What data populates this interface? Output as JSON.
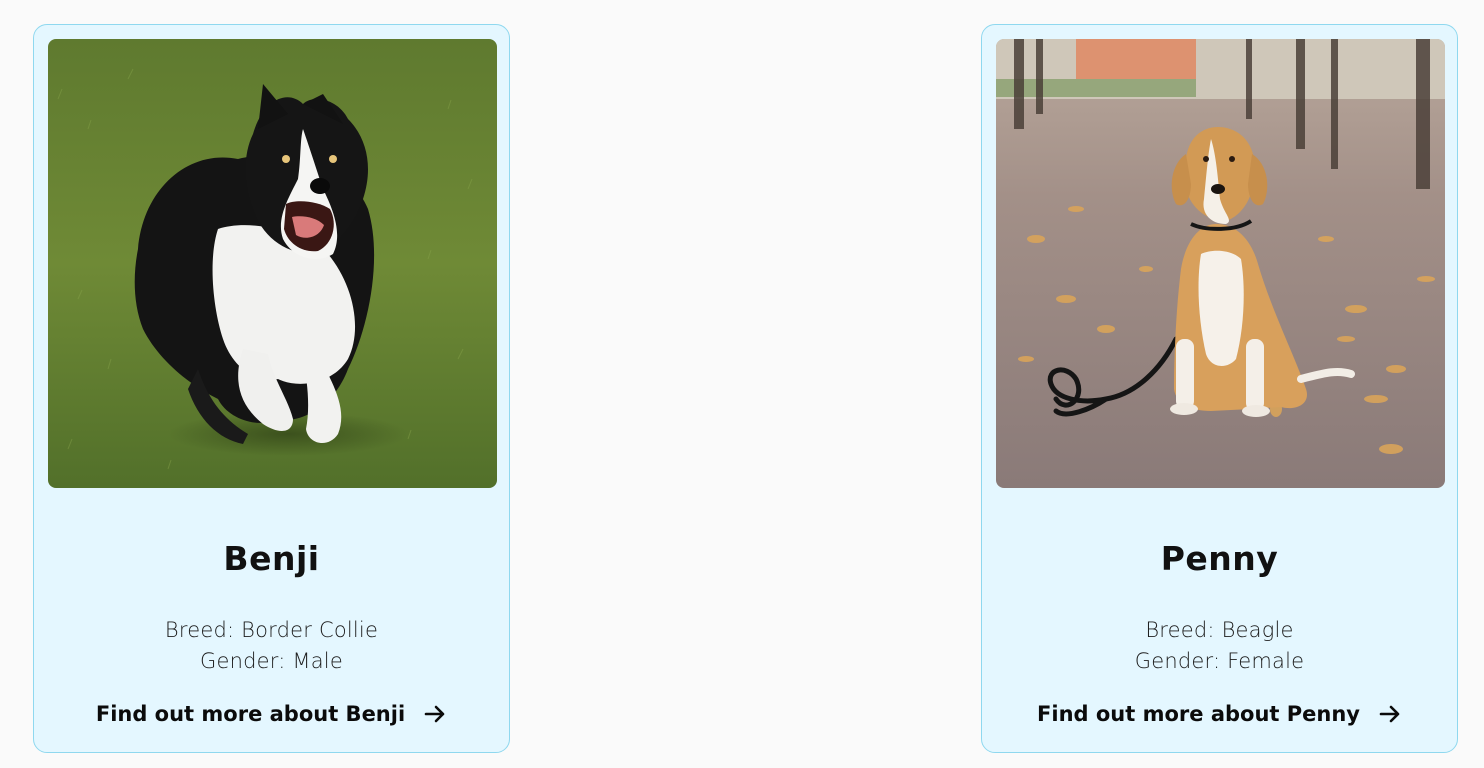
{
  "dogs": [
    {
      "name": "Benji",
      "breed": "Breed: Border Collie",
      "gender": "Gender: Male",
      "cta": "Find out more about Benji",
      "photo_icon": "border-collie-running-photo"
    },
    {
      "name": "Penny",
      "breed": "Breed: Beagle",
      "gender": "Gender: Female",
      "cta": "Find out more about Penny",
      "photo_icon": "beagle-sitting-photo"
    }
  ],
  "colors": {
    "page_bg": "#fafafa",
    "card_bg": "#e4f7ff",
    "card_border": "#8fd8ef",
    "text": "#111111"
  }
}
